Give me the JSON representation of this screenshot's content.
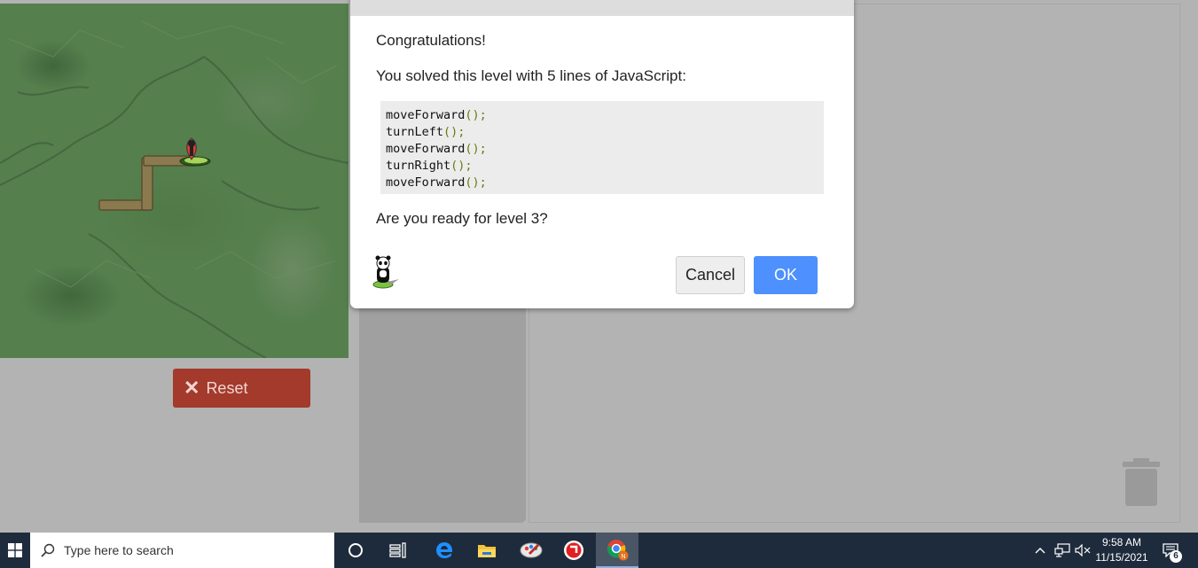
{
  "game": {
    "reset_label": "Reset"
  },
  "dialog": {
    "title": "Congratulations!",
    "solved_text": "You solved this level with 5 lines of JavaScript:",
    "code_lines": [
      {
        "name": "moveForward",
        "paren": "();"
      },
      {
        "name": "turnLeft",
        "paren": "();"
      },
      {
        "name": "moveForward",
        "paren": "();"
      },
      {
        "name": "turnRight",
        "paren": "();"
      },
      {
        "name": "moveForward",
        "paren": "();"
      }
    ],
    "ready_text": "Are you ready for level 3?",
    "cancel_label": "Cancel",
    "ok_label": "OK"
  },
  "taskbar": {
    "search_placeholder": "Type here to search",
    "time": "9:58 AM",
    "date": "11/15/2021",
    "notification_count": "6",
    "chrome_badge": "N"
  },
  "colors": {
    "ok_button": "#4d90fe",
    "reset_button": "#a33a2c",
    "code_paren": "#6b7a10",
    "taskbar": "#1e2b3c"
  },
  "icons": [
    "close-icon",
    "panda-icon",
    "trash-icon",
    "windows-icon",
    "search-icon",
    "cortana-icon",
    "task-view-icon",
    "edge-icon",
    "file-explorer-icon",
    "paint-icon",
    "app-icon",
    "chrome-icon",
    "chevron-up-icon",
    "network-icon",
    "volume-muted-icon",
    "notification-icon"
  ]
}
